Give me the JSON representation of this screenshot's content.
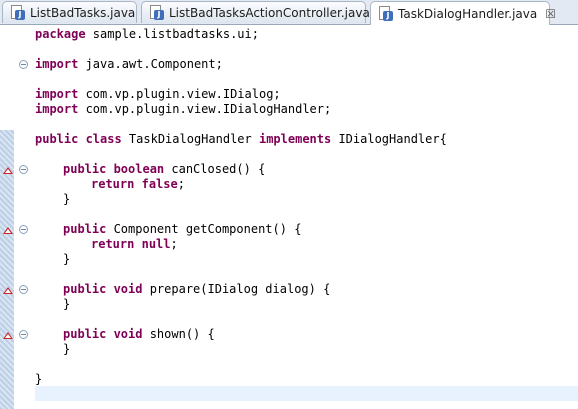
{
  "tabs": [
    {
      "label": "ListBadTasks.java",
      "active": false
    },
    {
      "label": "ListBadTasksActionController.java",
      "active": false
    },
    {
      "label": "TaskDialogHandler.java",
      "active": true
    }
  ],
  "close_glyph": "☒",
  "code_lines": [
    {
      "kw": "package",
      "rest": " sample.listbadtasks.ui;"
    },
    {
      "kw": "import",
      "rest": " java.awt.Component;"
    },
    {
      "kw": "import",
      "rest": " com.vp.plugin.view.IDialog;"
    },
    {
      "kw": "import",
      "rest": " com.vp.plugin.view.IDialogHandler;"
    },
    {
      "kw": "public class",
      "mid": " TaskDialogHandler ",
      "kw2": "implements",
      "rest": " IDialogHandler{"
    },
    {
      "kw": "public boolean",
      "rest": " canClosed() {"
    },
    {
      "kw": "return",
      "rest": " ",
      "kw2": "false",
      "tail": ";"
    },
    {
      "text": "}"
    },
    {
      "kw": "public",
      "rest": " Component getComponent() {"
    },
    {
      "kw": "return",
      "rest": " ",
      "kw2": "null",
      "tail": ";"
    },
    {
      "text": "}"
    },
    {
      "kw": "public void",
      "rest": " prepare(IDialog dialog) {"
    },
    {
      "text": "}"
    },
    {
      "kw": "public void",
      "rest": " shown() {"
    },
    {
      "text": "}"
    },
    {
      "text": "}"
    }
  ],
  "colors": {
    "keyword": "#7f0055",
    "current_line": "#e8f2fe",
    "ruler_band": "#bccfe6",
    "override_marker": "#c22a2a"
  }
}
